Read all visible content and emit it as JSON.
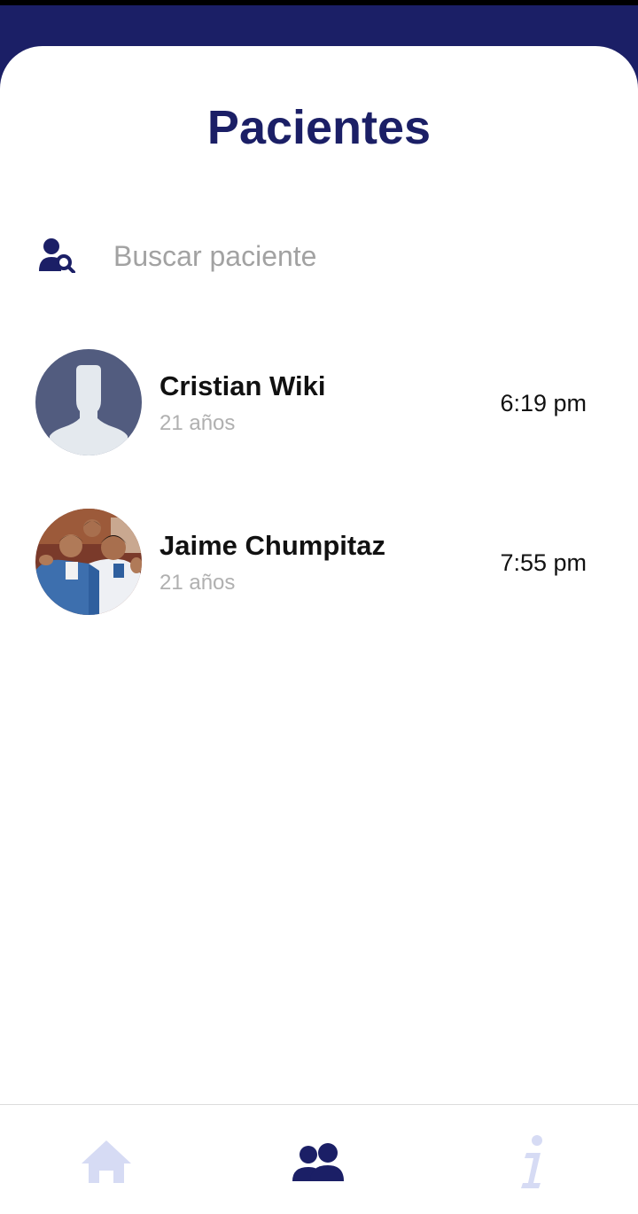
{
  "header": {
    "title": "Pacientes"
  },
  "search": {
    "placeholder": "Buscar paciente",
    "value": ""
  },
  "patients": [
    {
      "name": "Cristian Wiki",
      "age": "21 años",
      "time": "6:19 pm",
      "avatar": "default-avatar"
    },
    {
      "name": "Jaime Chumpitaz",
      "age": "21 años",
      "time": "7:55 pm",
      "avatar": "photo-avatar"
    }
  ],
  "bottom_nav": {
    "items": [
      {
        "icon": "home-icon",
        "active": false
      },
      {
        "icon": "users-icon",
        "active": true
      },
      {
        "icon": "info-icon",
        "active": false
      }
    ]
  },
  "colors": {
    "brand": "#1b1f66",
    "inactive_icon": "#d6dbf4",
    "muted_text": "#b0b0b0"
  }
}
